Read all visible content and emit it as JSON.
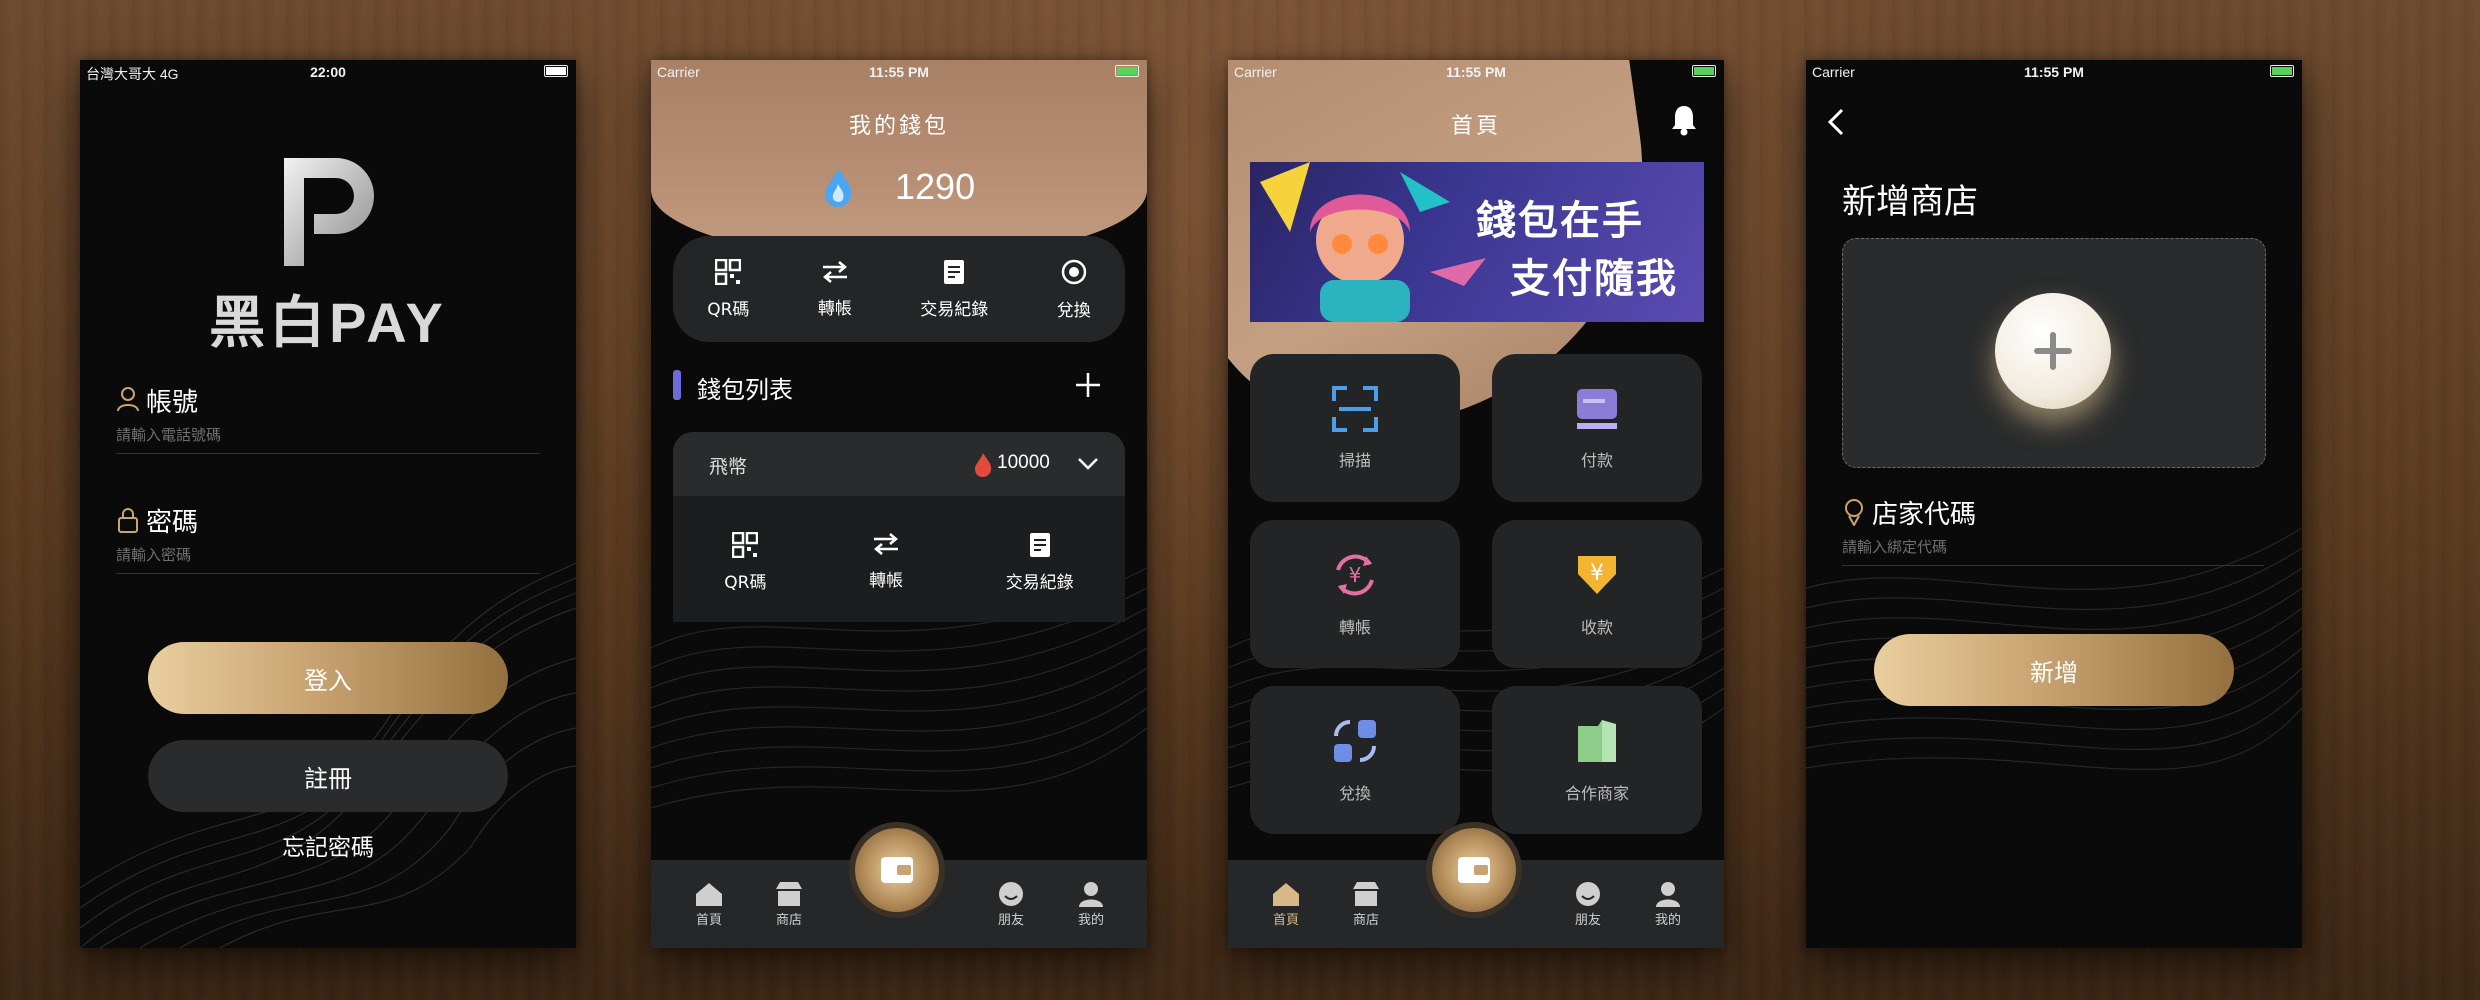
{
  "login": {
    "status": {
      "carrier": "台灣大哥大  4G",
      "time": "22:00"
    },
    "logo_text": "黑白PAY",
    "account_label": "帳號",
    "account_placeholder": "請輸入電話號碼",
    "password_label": "密碼",
    "password_placeholder": "請輸入密碼",
    "login_button": "登入",
    "register_button": "註冊",
    "forgot_link": "忘記密碼"
  },
  "wallet": {
    "status": {
      "carrier": "Carrier",
      "time": "11:55 PM"
    },
    "title": "我的錢包",
    "balance": "1290",
    "actions": [
      "QR碼",
      "轉帳",
      "交易紀錄",
      "兌換"
    ],
    "list_title": "錢包列表",
    "coin_name": "飛幣",
    "coin_amount": "10000",
    "coin_actions": [
      "QR碼",
      "轉帳",
      "交易紀錄"
    ]
  },
  "home": {
    "status": {
      "carrier": "Carrier",
      "time": "11:55 PM"
    },
    "title": "首頁",
    "banner_line1": "錢包在手",
    "banner_line2": "支付隨我",
    "grid": [
      "掃描",
      "付款",
      "轉帳",
      "收款",
      "兌換",
      "合作商家"
    ]
  },
  "tabs": [
    "首頁",
    "商店",
    "朋友",
    "我的"
  ],
  "add_store": {
    "status": {
      "carrier": "Carrier",
      "time": "11:55 PM"
    },
    "title": "新增商店",
    "code_label": "店家代碼",
    "code_placeholder": "請輸入綁定代碼",
    "add_button": "新增"
  },
  "colors": {
    "gold": "#c9a472",
    "accent_purple": "#6f6bd8",
    "accent_blue": "#4c9fe6",
    "accent_pink": "#e26fa3",
    "accent_yellow": "#f3b531",
    "accent_green": "#8ccd8a"
  }
}
